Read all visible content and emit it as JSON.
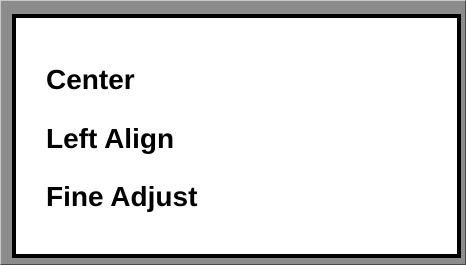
{
  "menu": {
    "items": [
      {
        "label": "Center"
      },
      {
        "label": "Left Align"
      },
      {
        "label": "Fine Adjust"
      }
    ]
  },
  "colors": {
    "frame": "#8c8c8c",
    "panel_background": "#ffffff",
    "panel_border": "#000000",
    "text": "#000000"
  }
}
